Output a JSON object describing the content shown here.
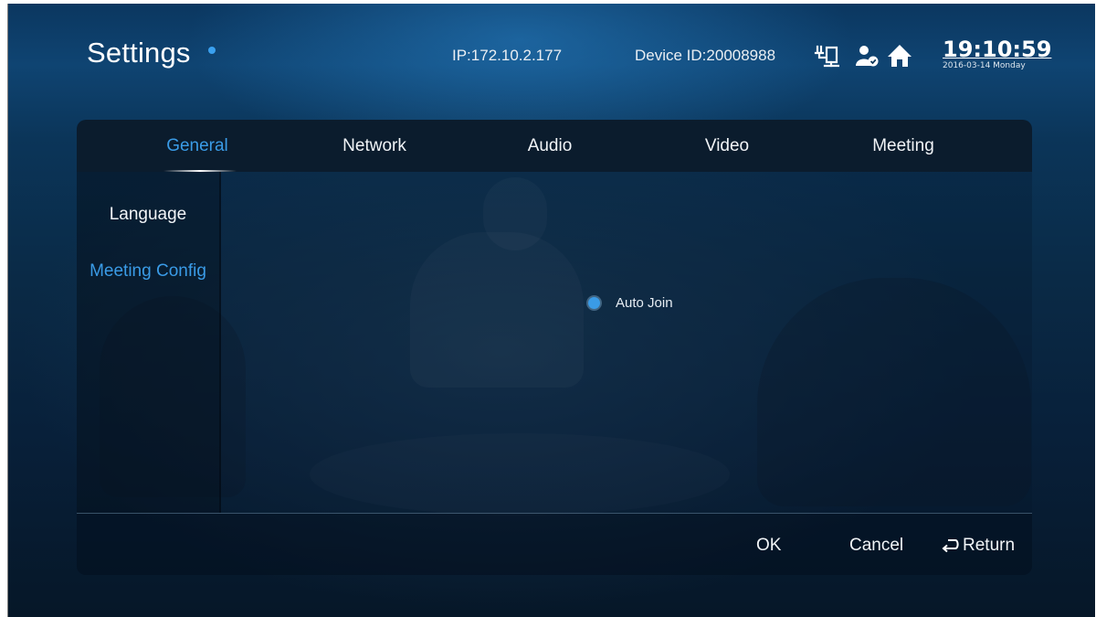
{
  "header": {
    "title": "Settings",
    "ip": "IP:172.10.2.177",
    "device_id": "Device ID:20008988",
    "time": "19:10:59",
    "date": "2016-03-14 Monday",
    "icons": [
      "network-icon",
      "user-status-icon",
      "home-icon"
    ]
  },
  "tabs": [
    {
      "label": "General",
      "active": true
    },
    {
      "label": "Network",
      "active": false
    },
    {
      "label": "Audio",
      "active": false
    },
    {
      "label": "Video",
      "active": false
    },
    {
      "label": "Meeting",
      "active": false
    }
  ],
  "sidebar": {
    "items": [
      {
        "label": "Language",
        "active": false
      },
      {
        "label": "Meeting Config",
        "active": true
      }
    ]
  },
  "content": {
    "option": {
      "label": "Auto Join",
      "selected": true
    }
  },
  "footer": {
    "ok_label": "OK",
    "cancel_label": "Cancel",
    "return_label": "Return"
  },
  "colors": {
    "accent": "#3a9be6",
    "text": "#f1f4f7",
    "tab_bar": "#0b1c2d"
  }
}
